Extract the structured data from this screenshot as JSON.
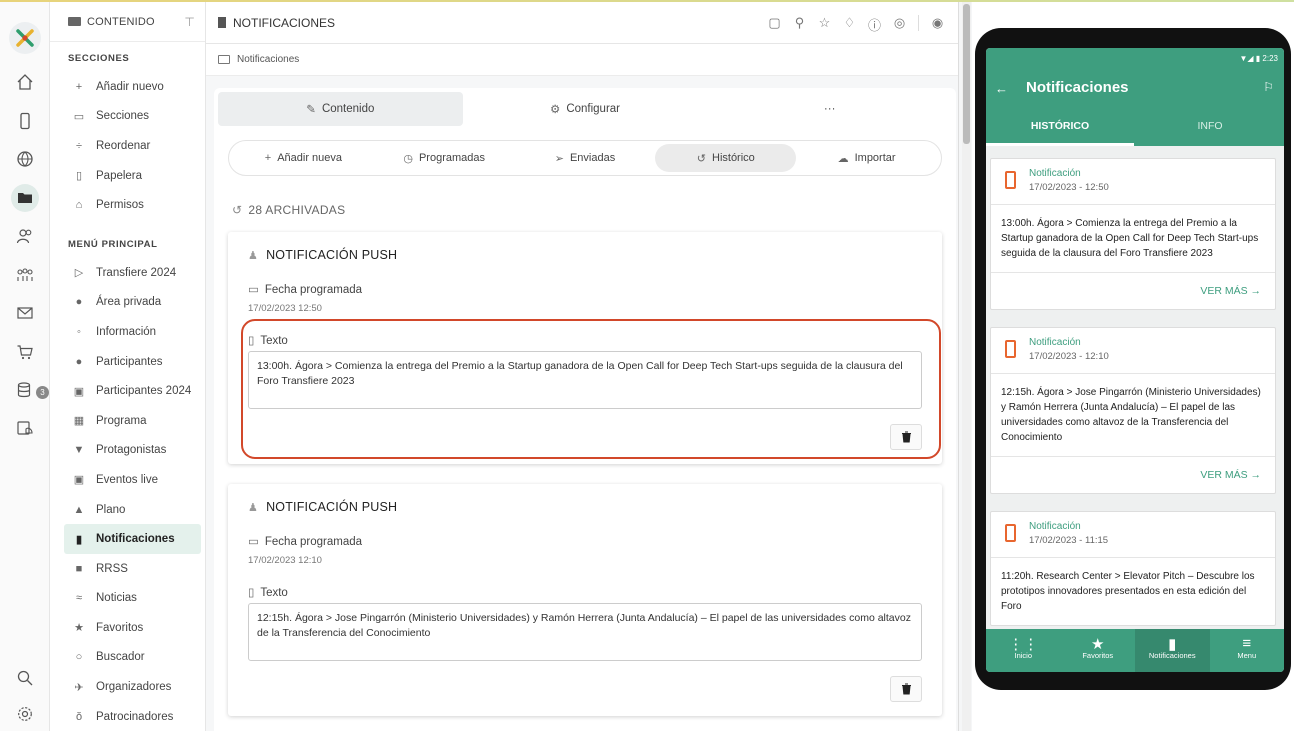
{
  "rail": {
    "items": [
      "home",
      "mobile",
      "globe",
      "folder",
      "users",
      "team",
      "mail",
      "cart",
      "database",
      "screen",
      "search",
      "settings"
    ],
    "badge": "3"
  },
  "menu": {
    "header": "CONTENIDO",
    "secciones_title": "SECCIONES",
    "secciones": [
      "Añadir nuevo",
      "Secciones",
      "Reordenar",
      "Papelera",
      "Permisos"
    ],
    "principal_title": "MENÚ PRINCIPAL",
    "principal": [
      "Transfiere 2024",
      "Área privada",
      "Información",
      "Participantes",
      "Participantes 2024",
      "Programa",
      "Protagonistas",
      "Eventos live",
      "Plano",
      "Notificaciones",
      "RRSS",
      "Noticias",
      "Favoritos",
      "Buscador",
      "Organizadores",
      "Patrocinadores"
    ],
    "active": "Notificaciones"
  },
  "main": {
    "title": "NOTIFICACIONES",
    "breadcrumb": "Notificaciones",
    "tabs": [
      "Contenido",
      "Configurar",
      "···"
    ],
    "subtabs": [
      "Añadir nueva",
      "Programadas",
      "Enviadas",
      "Histórico",
      "Importar"
    ],
    "archived": "28 ARCHIVADAS",
    "cards": [
      {
        "title": "NOTIFICACIÓN PUSH",
        "date_label": "Fecha programada",
        "date": "17/02/2023 12:50",
        "text_label": "Texto",
        "text": "13:00h. Ágora > Comienza la entrega del Premio a la Startup ganadora de la Open Call for Deep Tech Start-ups seguida de la clausura del Foro Transfiere 2023"
      },
      {
        "title": "NOTIFICACIÓN PUSH",
        "date_label": "Fecha programada",
        "date": "17/02/2023 12:10",
        "text_label": "Texto",
        "text": "12:15h. Ágora > Jose Pingarrón (Ministerio Universidades) y Ramón Herrera (Junta Andalucía) – El papel de las universidades como altavoz de la Transferencia del Conocimiento"
      }
    ]
  },
  "phone": {
    "status": "2:23",
    "title": "Notificaciones",
    "tabs": [
      "HISTÓRICO",
      "INFO"
    ],
    "cards": [
      {
        "type": "Notificación",
        "date": "17/02/2023 - 12:50",
        "text": "13:00h. Ágora > Comienza la entrega del Premio a la Startup ganadora de la Open Call for Deep Tech Start-ups seguida de la clausura del Foro Transfiere 2023",
        "more": "VER MÁS →"
      },
      {
        "type": "Notificación",
        "date": "17/02/2023 - 12:10",
        "text": "12:15h. Ágora > Jose Pingarrón (Ministerio Universidades) y Ramón Herrera (Junta Andalucía) – El papel de las universidades como altavoz de la Transferencia del Conocimiento",
        "more": "VER MÁS →"
      },
      {
        "type": "Notificación",
        "date": "17/02/2023 - 11:15",
        "text": "11:20h. Research Center > Elevator Pitch – Descubre los prototipos innovadores presentados en esta edición del Foro"
      }
    ],
    "nav": [
      "Inicio",
      "Favoritos",
      "Notificaciones",
      "Menu"
    ]
  },
  "colors": {
    "accent": "#3e9e7f",
    "highlight": "#d2482a",
    "phone_icon": "#e8662f"
  }
}
